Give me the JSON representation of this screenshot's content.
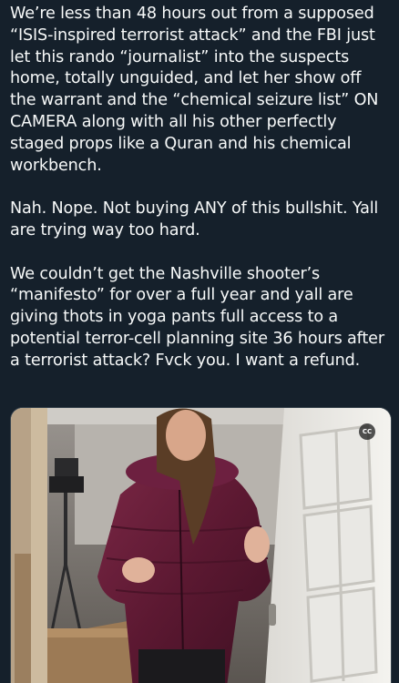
{
  "post": {
    "paragraphs": [
      "We’re less than 48 hours out from a supposed “ISIS-inspired terrorist attack” and the FBI just let this rando “journalist” into the suspects home, totally unguided, and let her show off the warrant and the “chemical seizure list” ON CAMERA along with all his other perfectly staged props like a Quran and his chemical workbench.",
      "Nah. Nope. Not buying ANY of this bullshit. Yall are trying way too hard.",
      "We couldn’t get the Nashville shooter’s “manifesto” for over a full year and yall are giving thots in yoga pants full access to a potential terror-cell planning site 36 hours after a terrorist attack? Fvck you. I want a refund."
    ]
  },
  "media": {
    "type": "video",
    "cc_label": "CC",
    "cc_icon": "closed-captions-icon"
  },
  "colors": {
    "background": "#15202b",
    "text": "#f7f9f9",
    "media_border": "#38444d"
  }
}
